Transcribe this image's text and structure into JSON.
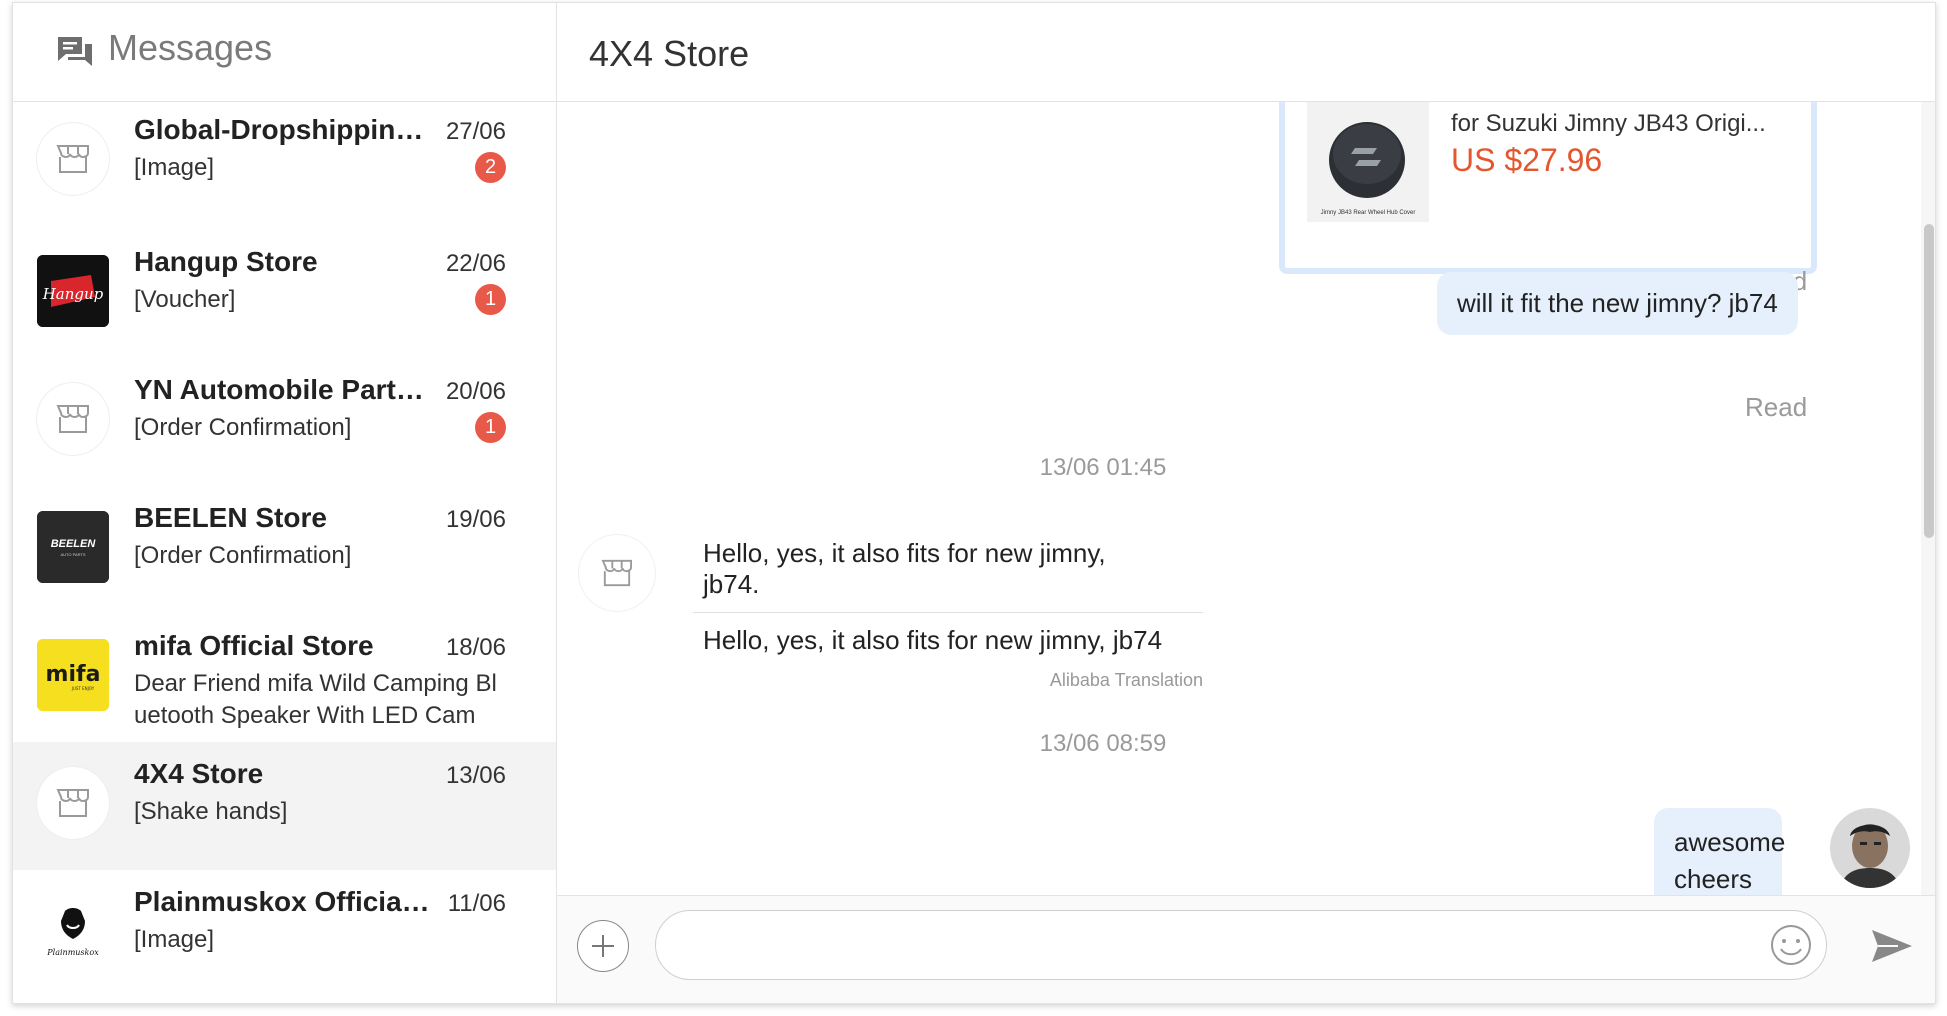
{
  "sidebar": {
    "title": "Messages",
    "conversations": [
      {
        "name": "Global-Dropshipping Store",
        "date": "27/06",
        "preview": "[Image]",
        "badge": "2",
        "avatar": "store-icon"
      },
      {
        "name": "Hangup Store",
        "date": "22/06",
        "preview": "[Voucher]",
        "badge": "1",
        "avatar": "hangup-logo"
      },
      {
        "name": "YN Automobile Parts Store",
        "date": "20/06",
        "preview": "[Order Confirmation]",
        "badge": "1",
        "avatar": "store-icon"
      },
      {
        "name": "BEELEN Store",
        "date": "19/06",
        "preview": "[Order Confirmation]",
        "badge": "",
        "avatar": "beelen-logo"
      },
      {
        "name": "mifa Official Store",
        "date": "18/06",
        "preview": "Dear Friend mifa Wild Camping Bl uetooth Speaker With LED Cam",
        "badge": "",
        "avatar": "mifa-logo"
      },
      {
        "name": "4X4 Store",
        "date": "13/06",
        "preview": "[Shake hands]",
        "badge": "",
        "avatar": "store-icon"
      },
      {
        "name": "Plainmuskox Official Store",
        "date": "11/06",
        "preview": "[Image]",
        "badge": "",
        "avatar": "plainmuskox-logo"
      }
    ],
    "logos": {
      "hangup": "Hangup",
      "beelen": "BEELEN",
      "beelen_sub": "AUTO PARTS",
      "mifa": "mifa",
      "mifa_sub": "JUST ENJOY",
      "plainmuskox": "Plainmuskox"
    }
  },
  "chat": {
    "title": "4X4 Store",
    "product": {
      "title": "for Suzuki Jimny JB43 Origi...",
      "price": "US $27.96",
      "thumb_caption": "Jimny JB43 Rear Wheel Hub Cover"
    },
    "read_label_1": "Read",
    "outgoing_1": "will it fit the new jimny? jb74",
    "read_label_2": "Read",
    "timestamp_1": "13/06 01:45",
    "incoming": {
      "original": "Hello, yes, it also fits for new jimny, jb74.",
      "translated": "Hello, yes, it also fits for new jimny, jb74",
      "translation_label": "Alibaba Translation"
    },
    "timestamp_2": "13/06 08:59",
    "outgoing_2": "awesome cheers"
  },
  "composer": {
    "placeholder": ""
  },
  "colors": {
    "accent": "#e6f0fc",
    "badge": "#e8594a",
    "price": "#e4572e"
  }
}
